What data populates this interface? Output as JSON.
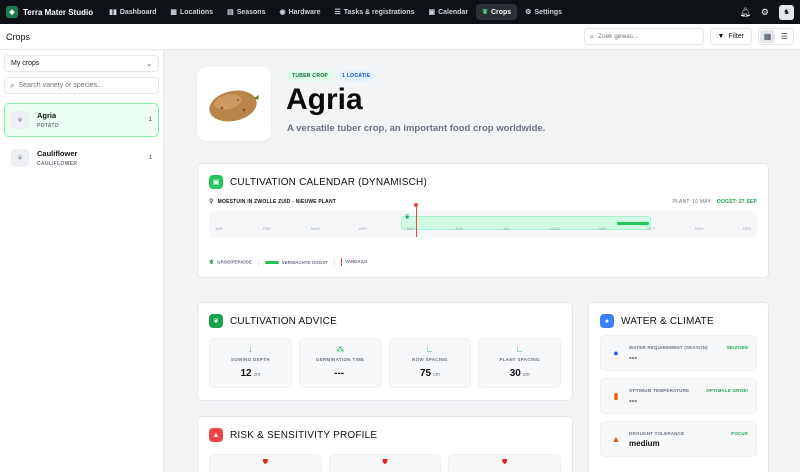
{
  "app": {
    "name": "Terra Mater Studio",
    "nav": [
      {
        "icon": "dashboard-icon",
        "glyph": "▮▮",
        "label": "Dashboard",
        "active": false
      },
      {
        "icon": "locations-icon",
        "glyph": "▦",
        "label": "Locations",
        "active": false
      },
      {
        "icon": "seasons-icon",
        "glyph": "▤",
        "label": "Seasons",
        "active": false
      },
      {
        "icon": "hardware-icon",
        "glyph": "◉",
        "label": "Hardware",
        "active": false
      },
      {
        "icon": "tasks-icon",
        "glyph": "☰",
        "label": "Tasks & registrations",
        "active": false
      },
      {
        "icon": "calendar-icon",
        "glyph": "▣",
        "label": "Calendar",
        "active": false
      },
      {
        "icon": "crops-icon",
        "glyph": "❦",
        "label": "Crops",
        "active": true
      },
      {
        "icon": "settings-icon",
        "glyph": "⚙",
        "label": "Settings",
        "active": false
      }
    ]
  },
  "header": {
    "title": "Crops",
    "search_placeholder": "Zoek gewas...",
    "filter_label": "Filter"
  },
  "sidebar": {
    "select_value": "My crops",
    "search_placeholder": "Search variety or species...",
    "items": [
      {
        "name": "Agria",
        "species": "POTATO",
        "count": "1",
        "active": true
      },
      {
        "name": "Cauliflower",
        "species": "CAULIFLOWER",
        "count": "1",
        "active": false
      }
    ]
  },
  "crop": {
    "tag_type": "TUBER CROP",
    "tag_location": "1 LOCATIE",
    "title": "Agria",
    "description": "A versatile tuber crop, an important food crop worldwide."
  },
  "calendar": {
    "title": "CULTIVATION CALENDAR (DYNAMISCH)",
    "location": "MOESTUIN IN ZWOLLE ZUID - NIEUWE PLANT",
    "plant_label": "PLANT: 10 MAY",
    "harvest_label": "OOGST: 27 SEP",
    "months": [
      "JAN",
      "FEB",
      "MAR",
      "APR",
      "MAY",
      "JUN",
      "JUL",
      "AUG",
      "SEP",
      "OCT",
      "NOV",
      "DEC"
    ],
    "legend": {
      "grow": "GROEIPERIODE",
      "harvest": "VERWACHTE OOGST",
      "today": "VANDAAG"
    },
    "accent": "#22c55e",
    "today_color": "#ef4444"
  },
  "advice": {
    "title": "CULTIVATION ADVICE",
    "stats": [
      {
        "icon": "arrow-down-icon",
        "glyph": "↓",
        "label": "SOWING DEPTH",
        "value": "12",
        "unit": "cm"
      },
      {
        "icon": "sprout-icon",
        "glyph": "⁂",
        "label": "GERMINATION TIME",
        "value": "---",
        "unit": ""
      },
      {
        "icon": "row-spacing-icon",
        "glyph": "∟",
        "label": "ROW SPACING",
        "value": "75",
        "unit": "cm"
      },
      {
        "icon": "plant-spacing-icon",
        "glyph": "∟",
        "label": "PLANT SPACING",
        "value": "30",
        "unit": "cm"
      }
    ]
  },
  "water": {
    "title": "WATER & CLIMATE",
    "items": [
      {
        "icon": "droplet-icon",
        "glyph": "●",
        "color": "#2563eb",
        "label": "WATER REQUIREMENT (SEASON)",
        "badge": "SEIZOEN",
        "value": "---"
      },
      {
        "icon": "thermometer-icon",
        "glyph": "▮",
        "color": "#ea580c",
        "label": "OPTIMUM TEMPERATURE",
        "badge": "OPTIMALE GROEI",
        "value": "---"
      },
      {
        "icon": "drought-icon",
        "glyph": "▲",
        "color": "#ea580c",
        "label": "DROUGHT TOLERANCE",
        "badge": "FOCUS",
        "value": "medium"
      }
    ]
  },
  "risk": {
    "title": "RISK & SENSITIVITY PROFILE"
  }
}
